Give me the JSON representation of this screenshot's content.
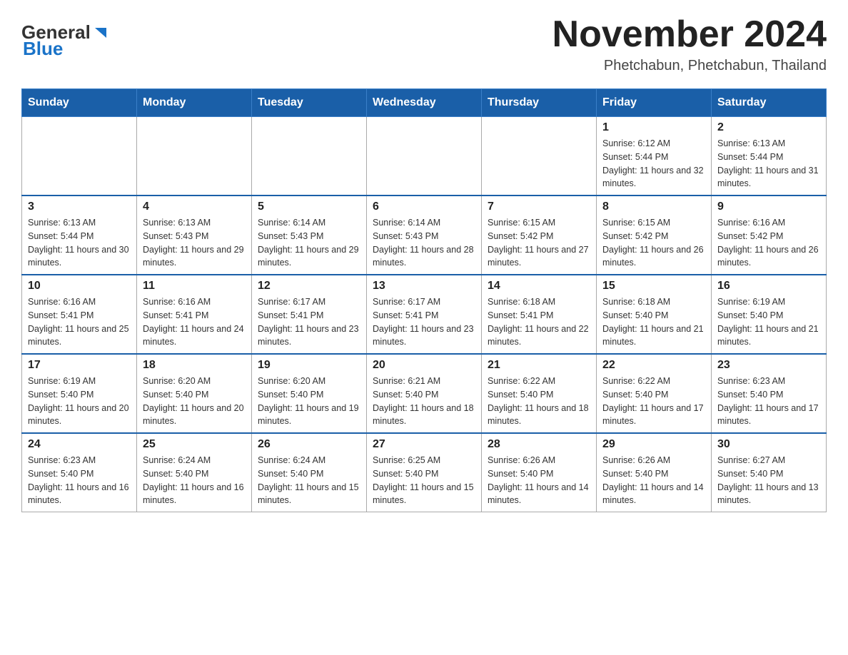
{
  "header": {
    "logo_general": "General",
    "logo_blue": "Blue",
    "title": "November 2024",
    "subtitle": "Phetchabun, Phetchabun, Thailand"
  },
  "calendar": {
    "days_of_week": [
      "Sunday",
      "Monday",
      "Tuesday",
      "Wednesday",
      "Thursday",
      "Friday",
      "Saturday"
    ],
    "weeks": [
      [
        {
          "day": "",
          "info": ""
        },
        {
          "day": "",
          "info": ""
        },
        {
          "day": "",
          "info": ""
        },
        {
          "day": "",
          "info": ""
        },
        {
          "day": "",
          "info": ""
        },
        {
          "day": "1",
          "info": "Sunrise: 6:12 AM\nSunset: 5:44 PM\nDaylight: 11 hours and 32 minutes."
        },
        {
          "day": "2",
          "info": "Sunrise: 6:13 AM\nSunset: 5:44 PM\nDaylight: 11 hours and 31 minutes."
        }
      ],
      [
        {
          "day": "3",
          "info": "Sunrise: 6:13 AM\nSunset: 5:44 PM\nDaylight: 11 hours and 30 minutes."
        },
        {
          "day": "4",
          "info": "Sunrise: 6:13 AM\nSunset: 5:43 PM\nDaylight: 11 hours and 29 minutes."
        },
        {
          "day": "5",
          "info": "Sunrise: 6:14 AM\nSunset: 5:43 PM\nDaylight: 11 hours and 29 minutes."
        },
        {
          "day": "6",
          "info": "Sunrise: 6:14 AM\nSunset: 5:43 PM\nDaylight: 11 hours and 28 minutes."
        },
        {
          "day": "7",
          "info": "Sunrise: 6:15 AM\nSunset: 5:42 PM\nDaylight: 11 hours and 27 minutes."
        },
        {
          "day": "8",
          "info": "Sunrise: 6:15 AM\nSunset: 5:42 PM\nDaylight: 11 hours and 26 minutes."
        },
        {
          "day": "9",
          "info": "Sunrise: 6:16 AM\nSunset: 5:42 PM\nDaylight: 11 hours and 26 minutes."
        }
      ],
      [
        {
          "day": "10",
          "info": "Sunrise: 6:16 AM\nSunset: 5:41 PM\nDaylight: 11 hours and 25 minutes."
        },
        {
          "day": "11",
          "info": "Sunrise: 6:16 AM\nSunset: 5:41 PM\nDaylight: 11 hours and 24 minutes."
        },
        {
          "day": "12",
          "info": "Sunrise: 6:17 AM\nSunset: 5:41 PM\nDaylight: 11 hours and 23 minutes."
        },
        {
          "day": "13",
          "info": "Sunrise: 6:17 AM\nSunset: 5:41 PM\nDaylight: 11 hours and 23 minutes."
        },
        {
          "day": "14",
          "info": "Sunrise: 6:18 AM\nSunset: 5:41 PM\nDaylight: 11 hours and 22 minutes."
        },
        {
          "day": "15",
          "info": "Sunrise: 6:18 AM\nSunset: 5:40 PM\nDaylight: 11 hours and 21 minutes."
        },
        {
          "day": "16",
          "info": "Sunrise: 6:19 AM\nSunset: 5:40 PM\nDaylight: 11 hours and 21 minutes."
        }
      ],
      [
        {
          "day": "17",
          "info": "Sunrise: 6:19 AM\nSunset: 5:40 PM\nDaylight: 11 hours and 20 minutes."
        },
        {
          "day": "18",
          "info": "Sunrise: 6:20 AM\nSunset: 5:40 PM\nDaylight: 11 hours and 20 minutes."
        },
        {
          "day": "19",
          "info": "Sunrise: 6:20 AM\nSunset: 5:40 PM\nDaylight: 11 hours and 19 minutes."
        },
        {
          "day": "20",
          "info": "Sunrise: 6:21 AM\nSunset: 5:40 PM\nDaylight: 11 hours and 18 minutes."
        },
        {
          "day": "21",
          "info": "Sunrise: 6:22 AM\nSunset: 5:40 PM\nDaylight: 11 hours and 18 minutes."
        },
        {
          "day": "22",
          "info": "Sunrise: 6:22 AM\nSunset: 5:40 PM\nDaylight: 11 hours and 17 minutes."
        },
        {
          "day": "23",
          "info": "Sunrise: 6:23 AM\nSunset: 5:40 PM\nDaylight: 11 hours and 17 minutes."
        }
      ],
      [
        {
          "day": "24",
          "info": "Sunrise: 6:23 AM\nSunset: 5:40 PM\nDaylight: 11 hours and 16 minutes."
        },
        {
          "day": "25",
          "info": "Sunrise: 6:24 AM\nSunset: 5:40 PM\nDaylight: 11 hours and 16 minutes."
        },
        {
          "day": "26",
          "info": "Sunrise: 6:24 AM\nSunset: 5:40 PM\nDaylight: 11 hours and 15 minutes."
        },
        {
          "day": "27",
          "info": "Sunrise: 6:25 AM\nSunset: 5:40 PM\nDaylight: 11 hours and 15 minutes."
        },
        {
          "day": "28",
          "info": "Sunrise: 6:26 AM\nSunset: 5:40 PM\nDaylight: 11 hours and 14 minutes."
        },
        {
          "day": "29",
          "info": "Sunrise: 6:26 AM\nSunset: 5:40 PM\nDaylight: 11 hours and 14 minutes."
        },
        {
          "day": "30",
          "info": "Sunrise: 6:27 AM\nSunset: 5:40 PM\nDaylight: 11 hours and 13 minutes."
        }
      ]
    ]
  }
}
